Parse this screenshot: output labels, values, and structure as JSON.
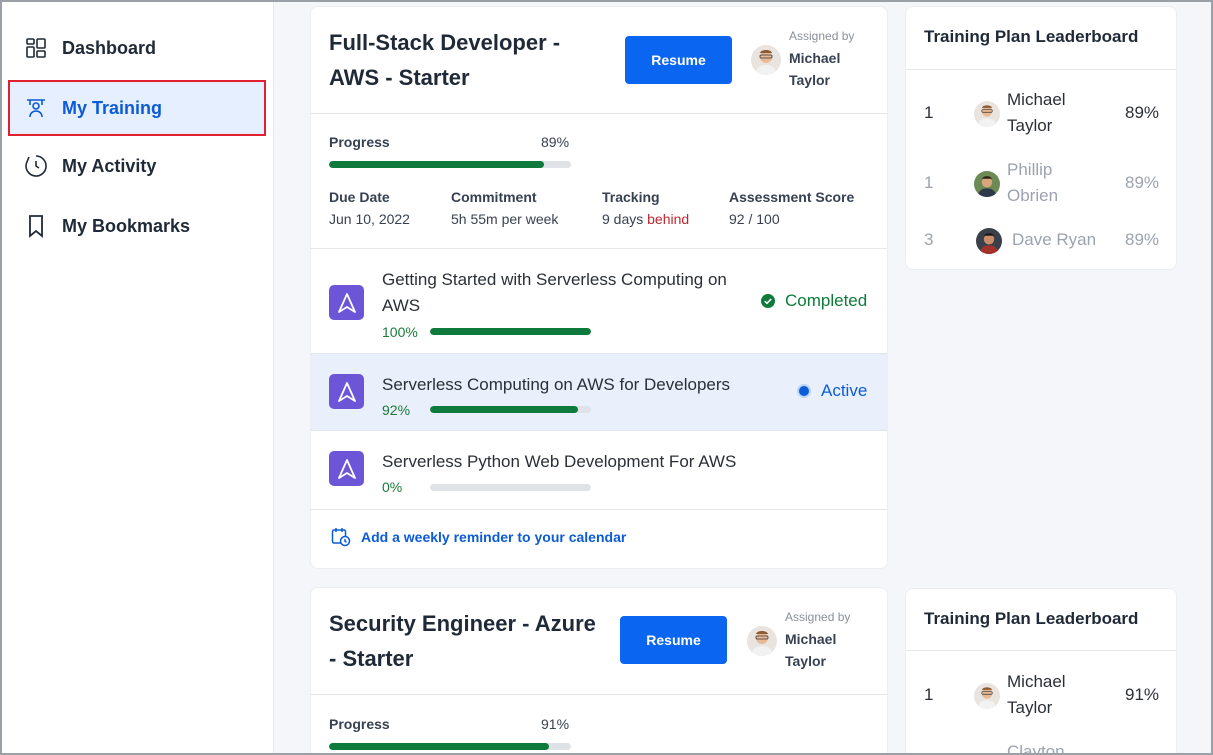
{
  "sidebar": {
    "items": [
      {
        "label": "Dashboard",
        "icon": "dashboard-icon"
      },
      {
        "label": "My Training",
        "icon": "training-icon",
        "active": true
      },
      {
        "label": "My Activity",
        "icon": "activity-icon"
      },
      {
        "label": "My Bookmarks",
        "icon": "bookmark-icon"
      }
    ]
  },
  "colors": {
    "accent": "#0a66f0",
    "progress": "#0e7a3b",
    "behind": "#c0262d",
    "course_icon": "#6c55d6"
  },
  "plans": [
    {
      "title": "Full-Stack Developer - AWS - Starter",
      "resume_label": "Resume",
      "assigned_label": "Assigned by",
      "assigned_name": "Michael Taylor",
      "progress_label": "Progress",
      "progress_pct": "89%",
      "progress_value": 89,
      "meta": {
        "due_label": "Due Date",
        "due_value": "Jun 10, 2022",
        "commitment_label": "Commitment",
        "commitment_value": "5h 55m per week",
        "tracking_label": "Tracking",
        "tracking_value": "9 days",
        "tracking_status": "behind",
        "score_label": "Assessment Score",
        "score_value": "92 / 100"
      },
      "courses": [
        {
          "title": "Getting Started with Serverless Computing on AWS",
          "pct": "100%",
          "value": 100,
          "status": "Completed"
        },
        {
          "title": "Serverless Computing on AWS for Developers",
          "pct": "92%",
          "value": 92,
          "status": "Active"
        },
        {
          "title": "Serverless Python Web Development For AWS",
          "pct": "0%",
          "value": 0,
          "status": ""
        }
      ],
      "reminder_label": "Add a weekly reminder to your calendar"
    },
    {
      "title": "Security Engineer - Azure - Starter",
      "resume_label": "Resume",
      "assigned_label": "Assigned by",
      "assigned_name": "Michael Taylor",
      "progress_label": "Progress",
      "progress_pct": "91%",
      "progress_value": 91
    }
  ],
  "leaderboards": [
    {
      "title": "Training Plan Leaderboard",
      "rows": [
        {
          "rank": "1",
          "name": "Michael Taylor",
          "pct": "89%"
        },
        {
          "rank": "1",
          "name": "Phillip Obrien",
          "pct": "89%"
        },
        {
          "rank": "3",
          "name": "Dave Ryan",
          "pct": "89%"
        }
      ]
    },
    {
      "title": "Training Plan Leaderboard",
      "rows": [
        {
          "rank": "1",
          "name": "Michael Taylor",
          "pct": "91%"
        },
        {
          "rank": "",
          "name": "Clayton",
          "pct": ""
        }
      ]
    }
  ]
}
